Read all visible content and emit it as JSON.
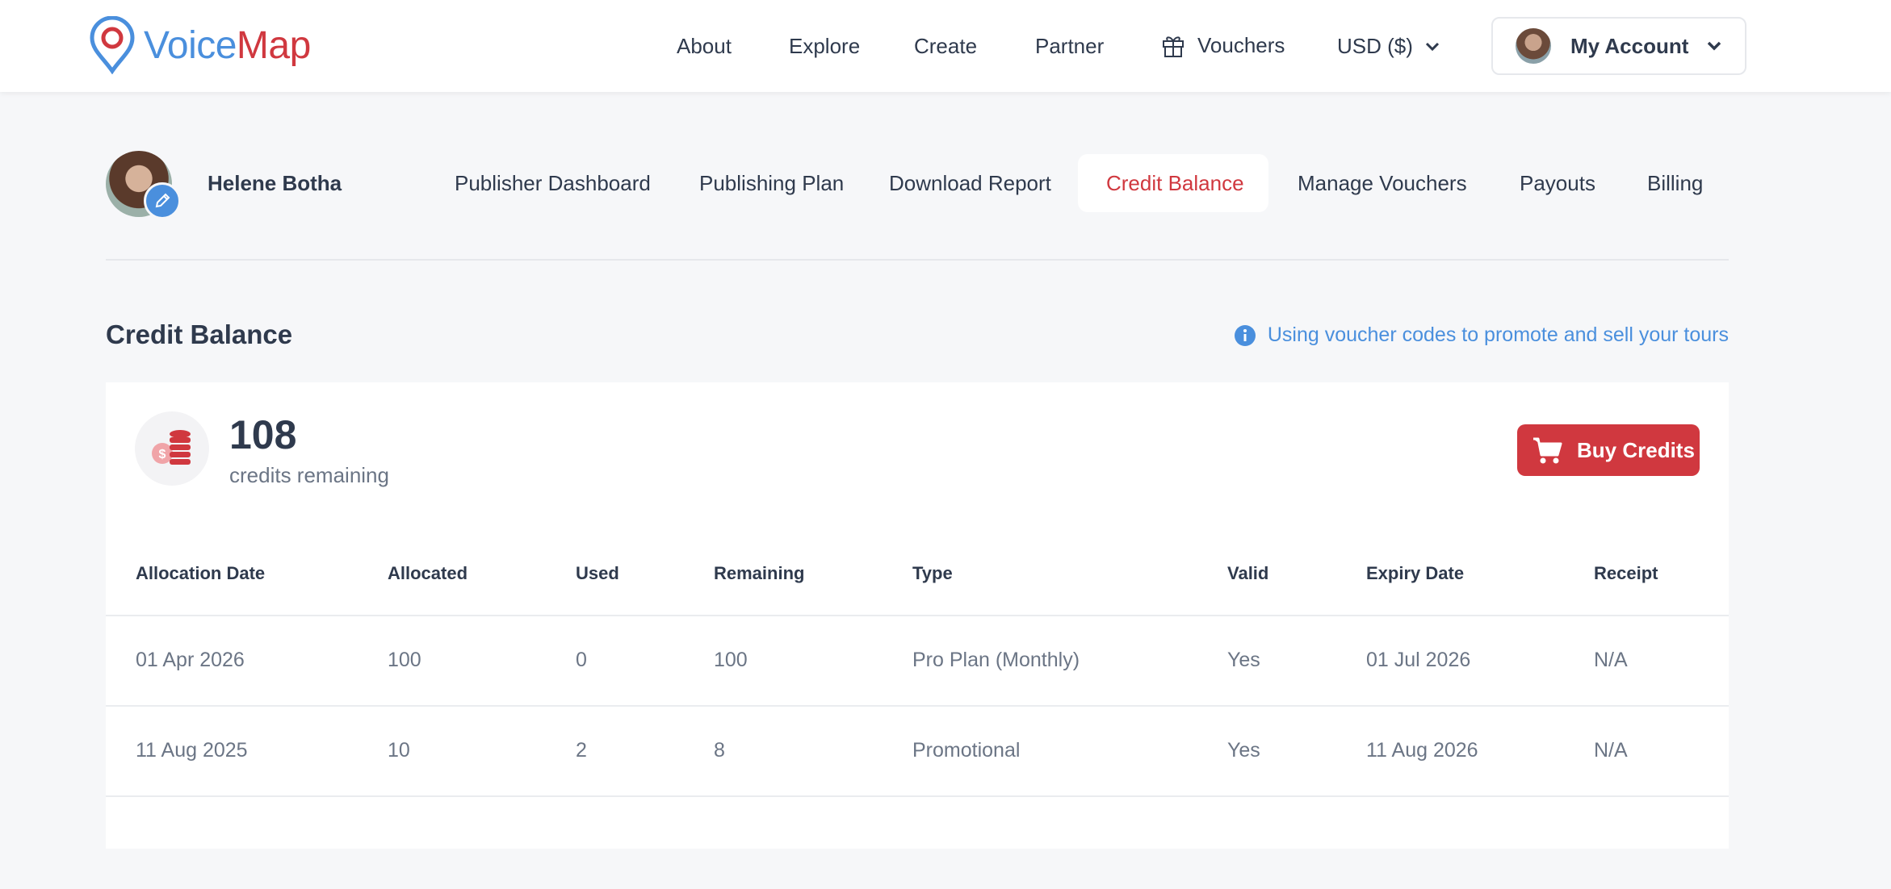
{
  "brand": {
    "voice": "Voice",
    "map": "Map",
    "accent": "#d0383f",
    "blue": "#4a8fdd"
  },
  "nav": {
    "about": "About",
    "explore": "Explore",
    "create": "Create",
    "partner": "Partner",
    "vouchers": "Vouchers",
    "currency": "USD ($)",
    "account": "My Account"
  },
  "profile": {
    "name": "Helene Botha"
  },
  "subnav": {
    "items": [
      "Publisher Dashboard",
      "Publishing Plan",
      "Download Report",
      "Credit Balance",
      "Manage Vouchers",
      "Payouts",
      "Billing"
    ],
    "active": "Credit Balance"
  },
  "page": {
    "title": "Credit Balance",
    "info_link": "Using voucher codes to promote and sell your tours"
  },
  "balance": {
    "credits": "108",
    "label": "credits remaining",
    "buy_label": "Buy Credits"
  },
  "table": {
    "headers": [
      "Allocation Date",
      "Allocated",
      "Used",
      "Remaining",
      "Type",
      "Valid",
      "Expiry Date",
      "Receipt"
    ],
    "rows": [
      [
        "01 Apr 2026",
        "100",
        "0",
        "100",
        "Pro Plan (Monthly)",
        "Yes",
        "01 Jul 2026",
        "N/A"
      ],
      [
        "11 Aug 2025",
        "10",
        "2",
        "8",
        "Promotional",
        "Yes",
        "11 Aug 2026",
        "N/A"
      ]
    ]
  }
}
